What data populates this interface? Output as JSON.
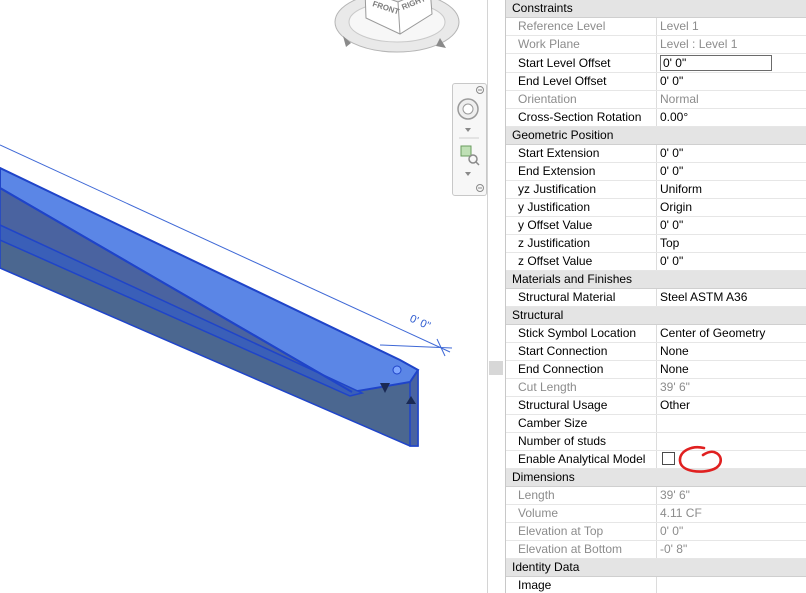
{
  "viewport": {
    "viewcube": {
      "face_front": "FRONT",
      "face_right": "RIGHT"
    },
    "dimension_label": "0'  0\"",
    "colors": {
      "beam_top": "#5b86e6",
      "beam_face": "#3a5fb8",
      "beam_side": "#4b6790",
      "beam_edge": "#1f44c9"
    }
  },
  "properties": {
    "sections": [
      {
        "title": "Constraints",
        "rows": [
          {
            "name": "Reference Level",
            "value": "Level 1",
            "disabled": true
          },
          {
            "name": "Work Plane",
            "value": "Level : Level 1",
            "disabled": true
          },
          {
            "name": "Start Level Offset",
            "value": "0'  0\"",
            "editing": true
          },
          {
            "name": "End Level Offset",
            "value": "0'  0\""
          },
          {
            "name": "Orientation",
            "value": "Normal",
            "disabled": true
          },
          {
            "name": "Cross-Section Rotation",
            "value": "0.00°"
          }
        ]
      },
      {
        "title": "Geometric Position",
        "rows": [
          {
            "name": "Start Extension",
            "value": "0'  0\""
          },
          {
            "name": "End Extension",
            "value": "0'  0\""
          },
          {
            "name": "yz Justification",
            "value": "Uniform"
          },
          {
            "name": "y Justification",
            "value": "Origin"
          },
          {
            "name": "y Offset Value",
            "value": "0'  0\""
          },
          {
            "name": "z Justification",
            "value": "Top"
          },
          {
            "name": "z Offset Value",
            "value": "0'  0\""
          }
        ]
      },
      {
        "title": "Materials and Finishes",
        "rows": [
          {
            "name": "Structural Material",
            "value": "Steel ASTM A36"
          }
        ]
      },
      {
        "title": "Structural",
        "rows": [
          {
            "name": "Stick Symbol Location",
            "value": "Center of Geometry"
          },
          {
            "name": "Start Connection",
            "value": "None"
          },
          {
            "name": "End Connection",
            "value": "None"
          },
          {
            "name": "Cut Length",
            "value": "39'  6\"",
            "disabled": true
          },
          {
            "name": "Structural Usage",
            "value": "Other"
          },
          {
            "name": "Camber Size",
            "value": ""
          },
          {
            "name": "Number of studs",
            "value": ""
          },
          {
            "name": "Enable Analytical Model",
            "value": "",
            "checkbox": true,
            "checked": false
          }
        ]
      },
      {
        "title": "Dimensions",
        "rows": [
          {
            "name": "Length",
            "value": "39'  6\"",
            "disabled": true
          },
          {
            "name": "Volume",
            "value": "4.11 CF",
            "disabled": true
          },
          {
            "name": "Elevation at Top",
            "value": "0'  0\"",
            "disabled": true
          },
          {
            "name": "Elevation at Bottom",
            "value": "-0'  8\"",
            "disabled": true
          }
        ]
      },
      {
        "title": "Identity Data",
        "rows": [
          {
            "name": "Image",
            "value": ""
          }
        ]
      }
    ]
  }
}
